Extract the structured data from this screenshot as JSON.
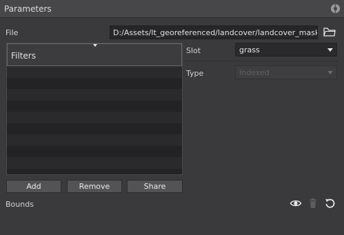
{
  "panel": {
    "title": "Parameters"
  },
  "file": {
    "label": "File",
    "value": "D:/Assets/lt_georeferenced/landcover/landcover_mask.tif"
  },
  "filters": {
    "label": "Filters",
    "rows": [
      "",
      "",
      "",
      "",
      "",
      "",
      "",
      "",
      "",
      ""
    ]
  },
  "slot": {
    "label": "Slot",
    "value": "grass"
  },
  "type": {
    "label": "Type",
    "value": "Indexed",
    "enabled": false
  },
  "buttons": {
    "add": "Add",
    "remove": "Remove",
    "share": "Share"
  },
  "bounds": {
    "label": "Bounds"
  },
  "icons": {
    "header": "settings-circle-icon",
    "folder": "folder-icon",
    "eye": "eye-icon",
    "trash": "trash-icon",
    "reset": "reset-icon"
  },
  "colors": {
    "panel_bg": "#3a3a3c",
    "header_bg": "#474749",
    "field_bg": "#262628",
    "button_bg": "#535355"
  }
}
